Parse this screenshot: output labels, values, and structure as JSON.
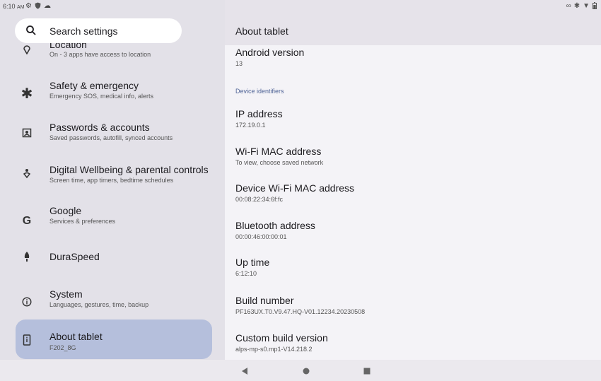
{
  "status": {
    "time": "6:10",
    "ampm": "AM",
    "left_icons": [
      "gear-icon",
      "shield-icon",
      "cloud-icon"
    ],
    "right_icons": [
      "link-icon",
      "bluetooth-icon",
      "wifi-icon",
      "battery-icon"
    ]
  },
  "search": {
    "placeholder": "Search settings"
  },
  "sidebar": {
    "items": [
      {
        "title": "Location",
        "subtitle": "On - 3 apps have access to location",
        "icon": "location-pin-icon"
      },
      {
        "title": "Safety & emergency",
        "subtitle": "Emergency SOS, medical info, alerts",
        "icon": "asterisk-icon"
      },
      {
        "title": "Passwords & accounts",
        "subtitle": "Saved passwords, autofill, synced accounts",
        "icon": "account-box-icon"
      },
      {
        "title": "Digital Wellbeing & parental controls",
        "subtitle": "Screen time, app timers, bedtime schedules",
        "icon": "wellbeing-icon"
      },
      {
        "title": "Google",
        "subtitle": "Services & preferences",
        "icon": "google-g-icon"
      },
      {
        "title": "DuraSpeed",
        "subtitle": "",
        "icon": "rocket-icon"
      },
      {
        "title": "System",
        "subtitle": "Languages, gestures, time, backup",
        "icon": "info-circle-icon"
      },
      {
        "title": "About tablet",
        "subtitle": "F202_8G",
        "icon": "tablet-info-icon"
      }
    ]
  },
  "main": {
    "title": "About tablet",
    "section_header": "Device identifiers",
    "items": [
      {
        "title": "Android version",
        "value": "13"
      },
      {
        "title": "IP address",
        "value": "172.19.0.1"
      },
      {
        "title": "Wi-Fi MAC address",
        "value": "To view, choose saved network"
      },
      {
        "title": "Device Wi-Fi MAC address",
        "value": "00:08:22:34:6f:fc"
      },
      {
        "title": "Bluetooth address",
        "value": "00:00:46:00:00:01"
      },
      {
        "title": "Up time",
        "value": "6:12:10"
      },
      {
        "title": "Build number",
        "value": "PF163UX.T0.V9.47.HQ-V01.12234.20230508"
      },
      {
        "title": "Custom build version",
        "value": "alps-mp-s0.mp1-V14.218.2"
      }
    ]
  },
  "navbar": {
    "buttons": [
      "back-icon",
      "home-icon",
      "recents-icon"
    ]
  }
}
